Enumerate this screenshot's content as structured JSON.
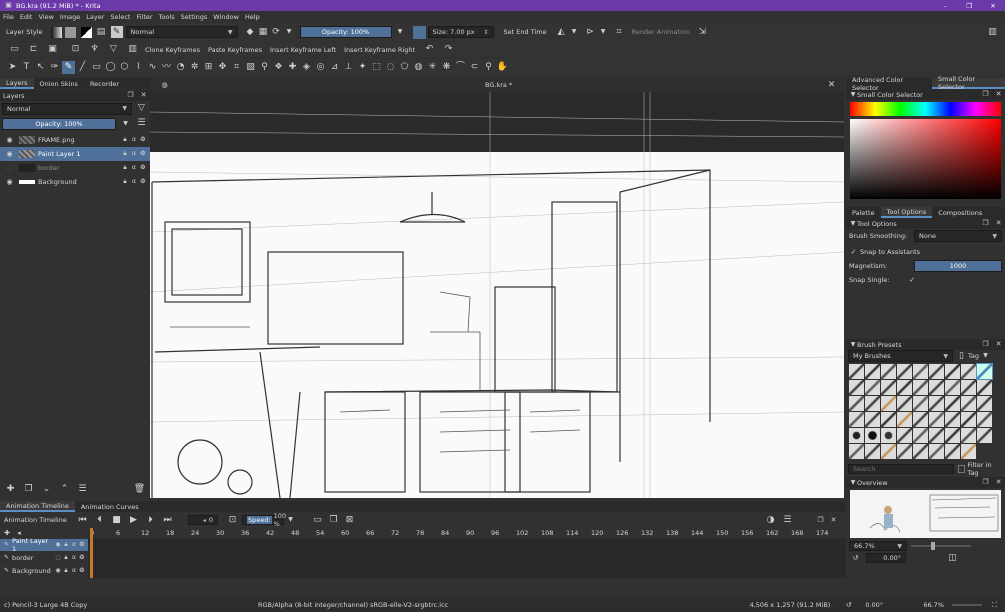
{
  "window": {
    "title": "BG.kra (91.2 MiB)  * - Krita",
    "controls": [
      "–",
      "❐",
      "✕"
    ]
  },
  "menu": [
    "File",
    "Edit",
    "View",
    "Image",
    "Layer",
    "Select",
    "Filter",
    "Tools",
    "Settings",
    "Window",
    "Help"
  ],
  "toolbar": {
    "layer_style": "Layer Style",
    "blend_mode": "Normal",
    "opacity": "Opacity: 100%",
    "size": "Size: 7.00 px",
    "set_end_time": "Set End Time",
    "render_animation": "Render Animation",
    "clone_keyframes": "Clone Keyframes",
    "paste_keyframes": "Paste Keyframes",
    "insert_keyframe_left": "Insert Keyframe Left",
    "insert_keyframe_right": "Insert Keyframe Right"
  },
  "left_tabs": [
    "Layers",
    "Onion Skins",
    "Recorder"
  ],
  "layers_panel": {
    "title": "Layers",
    "blend_mode": "Normal",
    "opacity": "Opacity:  100%",
    "layers": [
      {
        "name": "FRAME.png",
        "selected": false
      },
      {
        "name": "Paint Layer 1",
        "selected": true
      },
      {
        "name": "border",
        "selected": false
      },
      {
        "name": "Background",
        "selected": false
      }
    ]
  },
  "canvas": {
    "doc_title": "BG.kra *"
  },
  "right_panel": {
    "color_tabs": [
      "Advanced Color Selector",
      "Small Color Selector"
    ],
    "small_color_title": "Small Color Selector",
    "mid_tabs": [
      "Palette",
      "Tool Options",
      "Compositions"
    ],
    "tool_options_title": "Tool Options",
    "brush_smoothing_label": "Brush Smoothing:",
    "brush_smoothing_value": "None",
    "snap_assistants": "Snap to Assistants",
    "magnetism_label": "Magnetism:",
    "magnetism_value": "1000",
    "snap_single": "Snap Single:",
    "brush_presets_title": "Brush Presets",
    "my_brushes": "My Brushes",
    "tag_label": "Tag",
    "search_placeholder": "Search",
    "filter_in_tag": "Filter in Tag",
    "overview_title": "Overview",
    "zoom": "66.7%",
    "rotation": "0.00°"
  },
  "timeline": {
    "tabs": [
      "Animation Timeline",
      "Animation Curves"
    ],
    "title": "Animation Timeline",
    "frame": "0",
    "speed_label": "Speed:",
    "speed_value": "100 %",
    "ruler": [
      "0",
      "6",
      "12",
      "18",
      "24",
      "30",
      "36",
      "42",
      "48",
      "54",
      "60",
      "66",
      "72",
      "78",
      "84",
      "90",
      "96",
      "102",
      "108",
      "114",
      "120",
      "126",
      "132",
      "138",
      "144",
      "150",
      "156",
      "162",
      "168",
      "174"
    ],
    "layers": [
      "Paint Layer 1",
      "border",
      "Background"
    ]
  },
  "status": {
    "brush": "c) Pencil-3 Large 4B Copy",
    "color": "RGB/Alpha (8-bit integer/channel)  sRGB-elle-V2-srgbtrc.icc",
    "dims": "4,506 x 1,257 (91.2 MiB)",
    "rotation": "0.00°",
    "zoom": "66.7%"
  },
  "colors": {
    "titlebar": "#6a3aa8",
    "panel": "#313131",
    "selection": "#4f7099",
    "accent": "#5a8fc4"
  }
}
